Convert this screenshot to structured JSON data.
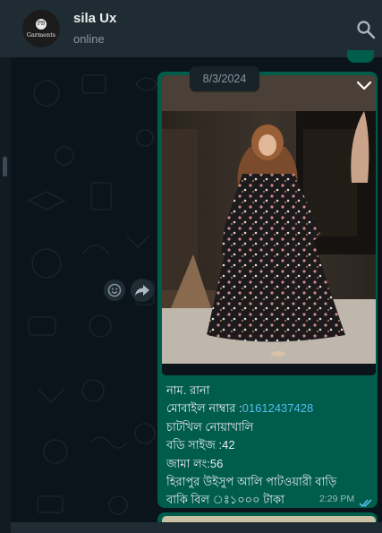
{
  "header": {
    "contact_name": "sila Ux",
    "status": "online",
    "avatar_text": "Garments",
    "avatar_mark": "PB"
  },
  "chat": {
    "date_chip": "8/3/2024",
    "message": {
      "caption_lines": [
        {
          "label": "নাম. রানা",
          "value": ""
        },
        {
          "label": "মোবাইল নাম্বার :",
          "value": "01612437428"
        },
        {
          "label": "চাটখিল নোয়াখালি",
          "value": ""
        },
        {
          "label": "বডি সাইজ :",
          "value": "42"
        },
        {
          "label": "জামা লং:",
          "value": "56"
        },
        {
          "label": "হিরাপুর  উইসুপ আলি পাটওয়ারী  বাড়ি",
          "value": ""
        },
        {
          "label": "বাকি বিল ঃ১০০০ টাকা",
          "value": ""
        }
      ],
      "time": "2:29 PM",
      "status": "read"
    }
  },
  "icons": {
    "search": "search-icon",
    "chevron": "chevron-down-icon",
    "emoji": "emoji-icon",
    "forward": "forward-icon",
    "ticks": "double-check-icon"
  },
  "colors": {
    "header_bg": "#202c33",
    "chat_bg": "#0b141a",
    "outgoing_bubble": "#005c4b",
    "link": "#53bdeb",
    "read_ticks": "#53bdeb"
  }
}
